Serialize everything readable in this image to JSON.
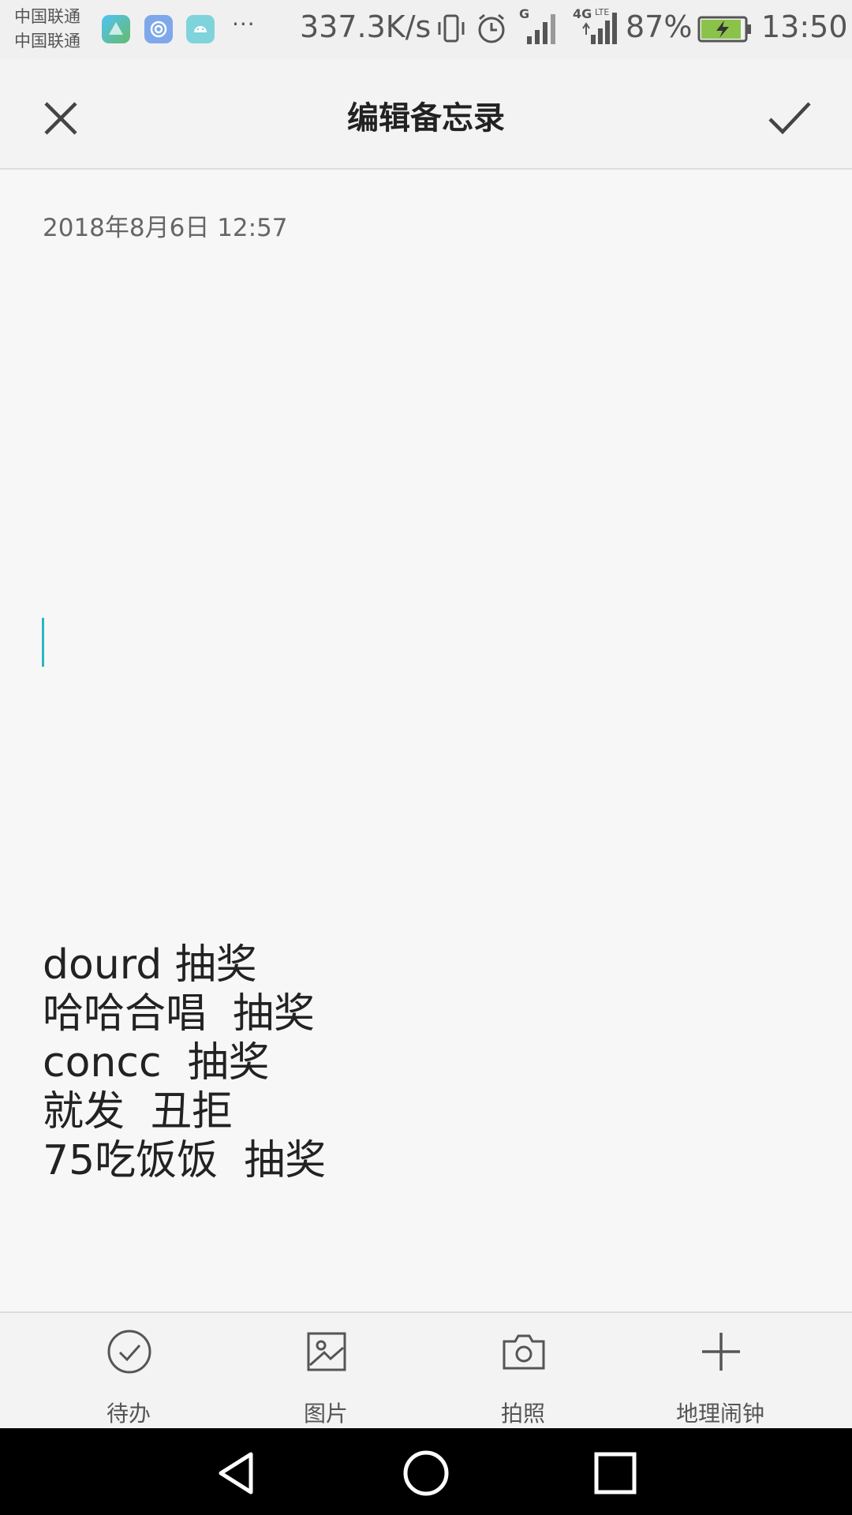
{
  "status_bar": {
    "carrier_1": "中国联通",
    "carrier_2": "中国联通",
    "more": "···",
    "net_speed": "337.3K/s",
    "network_g": "G",
    "network_4g": "4G",
    "network_lte": "LTE",
    "battery": "87%",
    "time": "13:50"
  },
  "toolbar": {
    "title": "编辑备忘录",
    "close_icon": "close-icon",
    "confirm_icon": "check-icon"
  },
  "editor": {
    "date": "2018年8月6日 12:57",
    "lines": [
      "dourd 抽奖",
      "哈哈合唱  抽奖",
      "concc  抽奖",
      "就发  丑拒",
      "75吃饭饭  抽奖"
    ]
  },
  "actions": [
    {
      "label": "待办",
      "icon": "todo-check-icon"
    },
    {
      "label": "图片",
      "icon": "image-icon"
    },
    {
      "label": "拍照",
      "icon": "camera-icon"
    },
    {
      "label": "地理闹钟",
      "icon": "plus-icon"
    }
  ],
  "colors": {
    "accent": "#2ab7c4",
    "background": "#f7f7f7",
    "battery_fill": "#8bc34a"
  }
}
